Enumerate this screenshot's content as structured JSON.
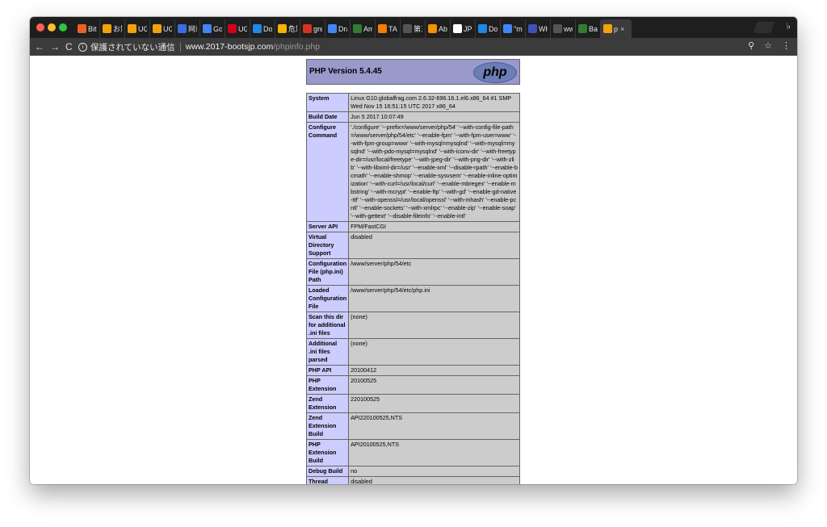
{
  "browser": {
    "tabs": [
      {
        "label": "Bitl",
        "icon": "bitly-icon",
        "color": "#ee6123"
      },
      {
        "label": "お影",
        "icon": "cart-icon",
        "color": "#f0a30a"
      },
      {
        "label": "UG",
        "icon": "cart-icon",
        "color": "#f0a30a"
      },
      {
        "label": "UG",
        "icon": "cart-icon",
        "color": "#f0a30a"
      },
      {
        "label": "网站",
        "icon": "translate-icon",
        "color": "#3b6de0"
      },
      {
        "label": "Go",
        "icon": "google-icon",
        "color": "#4285f4"
      },
      {
        "label": "UG",
        "icon": "heart-icon",
        "color": "#d0021b"
      },
      {
        "label": "Dor",
        "icon": "doc-icon",
        "color": "#1e88e5"
      },
      {
        "label": "危影",
        "icon": "circle-icon",
        "color": "#f5b400"
      },
      {
        "label": "gre",
        "icon": "mail-icon",
        "color": "#d93025"
      },
      {
        "label": "Dra",
        "icon": "google-icon",
        "color": "#4285f4"
      },
      {
        "label": "Am",
        "icon": "figure-icon",
        "color": "#2e7d32"
      },
      {
        "label": "TAI",
        "icon": "star-icon",
        "color": "#f57c00"
      },
      {
        "label": "第三",
        "icon": "page-icon",
        "color": "#555555"
      },
      {
        "label": "Abc",
        "icon": "circle-icon",
        "color": "#f09300"
      },
      {
        "label": "JPF",
        "icon": "jp-icon",
        "color": "#ffffff"
      },
      {
        "label": "Dor",
        "icon": "doc-icon",
        "color": "#1e88e5"
      },
      {
        "label": "\"m",
        "icon": "google-icon",
        "color": "#4285f4"
      },
      {
        "label": "WH",
        "icon": "c-icon",
        "color": "#3f51b5"
      },
      {
        "label": "ww",
        "icon": "page-icon",
        "color": "#555555"
      },
      {
        "label": "Bas",
        "icon": "dollar-icon",
        "color": "#2e7d32"
      },
      {
        "label": "p",
        "icon": "cart-icon",
        "color": "#f0a30a",
        "active": true
      }
    ],
    "toolbar": {
      "back": "←",
      "forward": "→",
      "reload": "C",
      "info": "i",
      "security_text": "保護されていない通信",
      "url_host": "www.2017-bootsjp.com",
      "url_path": "/phpinfo.php",
      "zoom_icon": "⚲",
      "star_icon": "☆",
      "menu_icon": "⋮",
      "close_tab": "×"
    }
  },
  "phpinfo": {
    "title": "PHP Version 5.4.45",
    "logo_text": "php",
    "colors": {
      "header": "#9999cc",
      "label_cell": "#ccccff",
      "value_cell": "#cccccc"
    },
    "rows": [
      {
        "label": "System",
        "value": "Linux G10.globalfrag.com 2.6.32-696.16.1.el6.x86_64 #1 SMP Wed Nov 15 16:51:15 UTC 2017 x86_64"
      },
      {
        "label": "Build Date",
        "value": "Jun 5 2017 10:07:49"
      },
      {
        "label": "Configure Command",
        "value": "'./configure' '--prefix=/www/server/php/54' '--with-config-file-path=/www/server/php/54/etc' '--enable-fpm' '--with-fpm-user=www' '--with-fpm-group=www' '--with-mysql=mysqlnd' '--with-mysqli=mysqlnd' '--with-pdo-mysql=mysqlnd' '--with-iconv-dir' '--with-freetype-dir=/usr/local/freetype' '--with-jpeg-dir' '--with-png-dir' '--with-zlib' '--with-libxml-dir=/usr' '--enable-xml' '--disable-rpath' '--enable-bcmath' '--enable-shmop' '--enable-sysvsem' '--enable-inline-optimization' '--with-curl=/usr/local/curl' '--enable-mbregex' '--enable-mbstring' '--with-mcrypt' '--enable-ftp' '--with-gd' '--enable-gd-native-ttf' '--with-openssl=/usr/local/openssl' '--with-mhash' '--enable-pcntl' '--enable-sockets' '--with-xmlrpc' '--enable-zip' '--enable-soap' '--with-gettext' '--disable-fileinfo' '--enable-intl'"
      },
      {
        "label": "Server API",
        "value": "FPM/FastCGI"
      },
      {
        "label": "Virtual Directory Support",
        "value": "disabled"
      },
      {
        "label": "Configuration File (php.ini) Path",
        "value": "/www/server/php/54/etc"
      },
      {
        "label": "Loaded Configuration File",
        "value": "/www/server/php/54/etc/php.ini"
      },
      {
        "label": "Scan this dir for additional .ini files",
        "value": "(none)"
      },
      {
        "label": "Additional .ini files parsed",
        "value": "(none)"
      },
      {
        "label": "PHP API",
        "value": "20100412"
      },
      {
        "label": "PHP Extension",
        "value": "20100525"
      },
      {
        "label": "Zend Extension",
        "value": "220100525"
      },
      {
        "label": "Zend Extension Build",
        "value": "API220100525,NTS"
      },
      {
        "label": "PHP Extension Build",
        "value": "API20100525,NTS"
      },
      {
        "label": "Debug Build",
        "value": "no"
      },
      {
        "label": "Thread Safety",
        "value": "disabled"
      }
    ]
  }
}
